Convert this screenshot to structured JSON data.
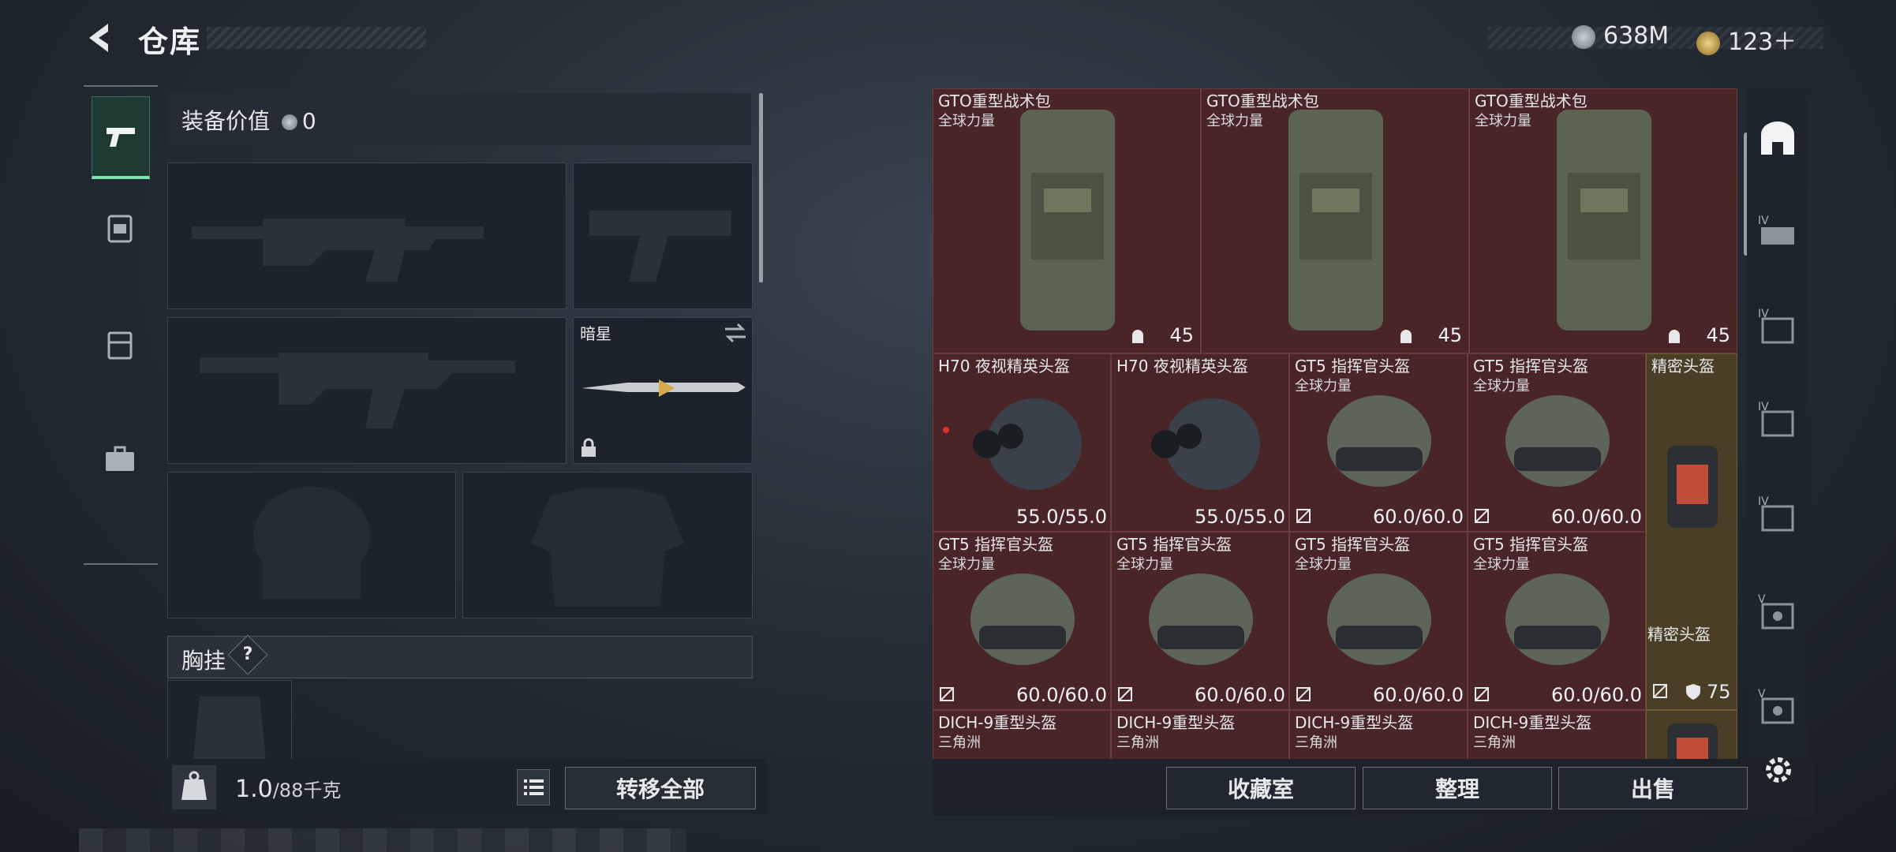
{
  "header": {
    "title": "仓库",
    "currency_silver": "638M",
    "currency_gold": "123＋",
    "colors": {
      "silver": "#9aa3ad",
      "gold": "#c8a24a"
    }
  },
  "left_nav": {
    "items": [
      {
        "name": "weapon",
        "icon": "pistol-icon",
        "active": true
      },
      {
        "name": "backpack",
        "icon": "backpack-icon",
        "active": false
      },
      {
        "name": "rig",
        "icon": "rig-icon",
        "active": false
      },
      {
        "name": "case",
        "icon": "briefcase-icon",
        "active": false
      }
    ]
  },
  "loadout": {
    "value_label": "装备价值",
    "value_amount": "0",
    "melee_name": "暗星",
    "chest_rig_label": "胸挂",
    "chest_rig_help": "?",
    "weight_current": "1.0",
    "weight_max": "/88千克",
    "transfer_all": "转移全部"
  },
  "storage": {
    "rows": [
      [
        {
          "name": "GTO重型战术包",
          "sub": "全球力量",
          "value": "45",
          "type": "backpack"
        },
        {
          "name": "GTO重型战术包",
          "sub": "全球力量",
          "value": "45",
          "type": "backpack"
        },
        {
          "name": "GTO重型战术包",
          "sub": "全球力量",
          "value": "45",
          "type": "backpack"
        }
      ],
      [
        {
          "name": "H70 夜视精英头盔",
          "sub": "",
          "durability": "55.0/55.0",
          "type": "nvg"
        },
        {
          "name": "H70 夜视精英头盔",
          "sub": "",
          "durability": "55.0/55.0",
          "type": "nvg"
        },
        {
          "name": "GT5 指挥官头盔",
          "sub": "全球力量",
          "durability": "60.0/60.0",
          "type": "helmet"
        },
        {
          "name": "GT5 指挥官头盔",
          "sub": "全球力量",
          "durability": "60.0/60.0",
          "type": "helmet"
        }
      ],
      [
        {
          "name": "GT5 指挥官头盔",
          "sub": "全球力量",
          "durability": "60.0/60.0",
          "type": "helmet"
        },
        {
          "name": "GT5 指挥官头盔",
          "sub": "全球力量",
          "durability": "60.0/60.0",
          "type": "helmet"
        },
        {
          "name": "GT5 指挥官头盔",
          "sub": "全球力量",
          "durability": "60.0/60.0",
          "type": "helmet"
        },
        {
          "name": "GT5 指挥官头盔",
          "sub": "全球力量",
          "durability": "60.0/60.0",
          "type": "helmet"
        }
      ],
      [
        {
          "name": "DICH-9重型头盔",
          "sub": "三角洲",
          "type": "helmet"
        },
        {
          "name": "DICH-9重型头盔",
          "sub": "三角洲",
          "type": "helmet"
        },
        {
          "name": "DICH-9重型头盔",
          "sub": "三角洲",
          "type": "helmet"
        },
        {
          "name": "DICH-9重型头盔",
          "sub": "三角洲",
          "type": "helmet"
        }
      ]
    ],
    "side_items": [
      {
        "name": "精密头盔",
        "type": "case"
      },
      {
        "name": "精密头盔",
        "value": "75",
        "type": "case"
      }
    ],
    "actions": {
      "collection": "收藏室",
      "sort": "整理",
      "sell": "出售"
    }
  },
  "right_sidebar": {
    "tabs": [
      "home-icon",
      "iv-1",
      "iv-2",
      "iv-3",
      "iv-4",
      "v-1",
      "v-2"
    ],
    "tab_labels": [
      "IV",
      "IV",
      "IV",
      "IV",
      "V",
      "V"
    ],
    "settings": "gear-icon"
  }
}
